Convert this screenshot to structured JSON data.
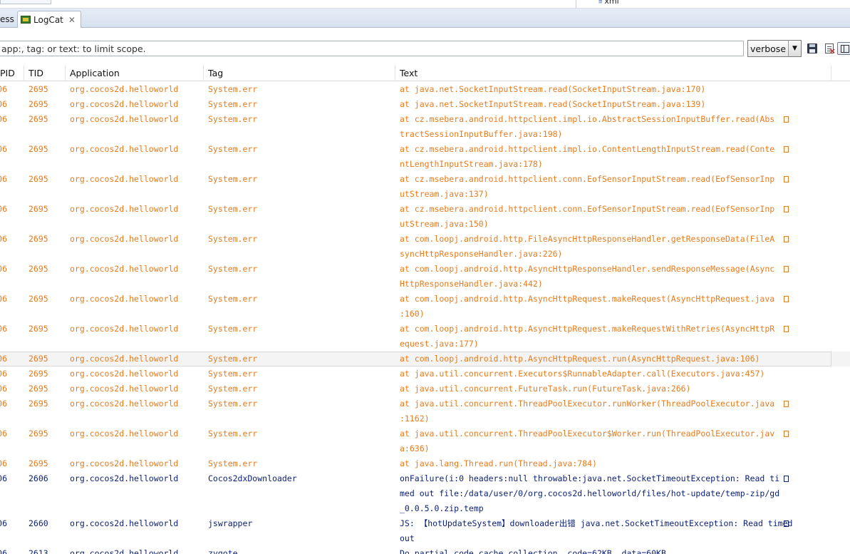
{
  "top": {
    "file_label": "xml"
  },
  "tabs": {
    "previous_label": "ess",
    "logcat_label": "LogCat"
  },
  "search": {
    "placeholder": "app:, tag: or text: to limit scope."
  },
  "level": {
    "value": "verbose"
  },
  "colors": {
    "warn_text": "#e87b1c",
    "info_text": "#0a1f78",
    "tab_bg": "#dde6f2"
  },
  "icons": {
    "tab": "logcat-icon",
    "close": "close-icon",
    "save": "save-icon",
    "clear": "clear-log-icon",
    "layout": "layout-toggle-icon"
  },
  "table": {
    "columns": [
      "PID",
      "TID",
      "Application",
      "Tag",
      "Text"
    ],
    "rows": [
      {
        "level": "warn",
        "pid": "06",
        "tid": "2695",
        "app": "org.cocos2d.helloworld",
        "tag": "System.err",
        "text": [
          "at java.net.SocketInputStream.read(SocketInputStream.java:170)"
        ]
      },
      {
        "level": "warn",
        "pid": "06",
        "tid": "2695",
        "app": "org.cocos2d.helloworld",
        "tag": "System.err",
        "text": [
          "at java.net.SocketInputStream.read(SocketInputStream.java:139)"
        ]
      },
      {
        "level": "warn",
        "pid": "06",
        "tid": "2695",
        "app": "org.cocos2d.helloworld",
        "tag": "System.err",
        "text": [
          "at cz.msebera.android.httpclient.impl.io.AbstractSessionInputBuffer.read(Abs",
          "tractSessionInputBuffer.java:198)"
        ]
      },
      {
        "level": "warn",
        "pid": "06",
        "tid": "2695",
        "app": "org.cocos2d.helloworld",
        "tag": "System.err",
        "text": [
          "at cz.msebera.android.httpclient.impl.io.ContentLengthInputStream.read(Conte",
          "ntLengthInputStream.java:178)"
        ]
      },
      {
        "level": "warn",
        "pid": "06",
        "tid": "2695",
        "app": "org.cocos2d.helloworld",
        "tag": "System.err",
        "text": [
          "at cz.msebera.android.httpclient.conn.EofSensorInputStream.read(EofSensorInp",
          "utStream.java:137)"
        ]
      },
      {
        "level": "warn",
        "pid": "06",
        "tid": "2695",
        "app": "org.cocos2d.helloworld",
        "tag": "System.err",
        "text": [
          "at cz.msebera.android.httpclient.conn.EofSensorInputStream.read(EofSensorInp",
          "utStream.java:150)"
        ]
      },
      {
        "level": "warn",
        "pid": "06",
        "tid": "2695",
        "app": "org.cocos2d.helloworld",
        "tag": "System.err",
        "text": [
          "at com.loopj.android.http.FileAsyncHttpResponseHandler.getResponseData(FileA",
          "syncHttpResponseHandler.java:226)"
        ]
      },
      {
        "level": "warn",
        "pid": "06",
        "tid": "2695",
        "app": "org.cocos2d.helloworld",
        "tag": "System.err",
        "text": [
          "at com.loopj.android.http.AsyncHttpResponseHandler.sendResponseMessage(Async",
          "HttpResponseHandler.java:442)"
        ]
      },
      {
        "level": "warn",
        "pid": "06",
        "tid": "2695",
        "app": "org.cocos2d.helloworld",
        "tag": "System.err",
        "text": [
          "at com.loopj.android.http.AsyncHttpRequest.makeRequest(AsyncHttpRequest.java",
          ":160)"
        ]
      },
      {
        "level": "warn",
        "pid": "06",
        "tid": "2695",
        "app": "org.cocos2d.helloworld",
        "tag": "System.err",
        "text": [
          "at com.loopj.android.http.AsyncHttpRequest.makeRequestWithRetries(AsyncHttpR",
          "equest.java:177)"
        ]
      },
      {
        "level": "warn",
        "selected": true,
        "pid": "06",
        "tid": "2695",
        "app": "org.cocos2d.helloworld",
        "tag": "System.err",
        "text": [
          "at com.loopj.android.http.AsyncHttpRequest.run(AsyncHttpRequest.java:106)"
        ]
      },
      {
        "level": "warn",
        "pid": "06",
        "tid": "2695",
        "app": "org.cocos2d.helloworld",
        "tag": "System.err",
        "text": [
          "at java.util.concurrent.Executors$RunnableAdapter.call(Executors.java:457)"
        ]
      },
      {
        "level": "warn",
        "pid": "06",
        "tid": "2695",
        "app": "org.cocos2d.helloworld",
        "tag": "System.err",
        "text": [
          "at java.util.concurrent.FutureTask.run(FutureTask.java:266)"
        ]
      },
      {
        "level": "warn",
        "pid": "06",
        "tid": "2695",
        "app": "org.cocos2d.helloworld",
        "tag": "System.err",
        "text": [
          "at java.util.concurrent.ThreadPoolExecutor.runWorker(ThreadPoolExecutor.java",
          ":1162)"
        ]
      },
      {
        "level": "warn",
        "pid": "06",
        "tid": "2695",
        "app": "org.cocos2d.helloworld",
        "tag": "System.err",
        "text": [
          "at java.util.concurrent.ThreadPoolExecutor$Worker.run(ThreadPoolExecutor.jav",
          "a:636)"
        ]
      },
      {
        "level": "warn",
        "pid": "06",
        "tid": "2695",
        "app": "org.cocos2d.helloworld",
        "tag": "System.err",
        "text": [
          "at java.lang.Thread.run(Thread.java:784)"
        ]
      },
      {
        "level": "info",
        "pid": "06",
        "tid": "2606",
        "app": "org.cocos2d.helloworld",
        "tag": "Cocos2dxDownloader",
        "text": [
          "onFailure(i:0 headers:null throwable:java.net.SocketTimeoutException: Read ti",
          "med out file:/data/user/0/org.cocos2d.helloworld/files/hot-update/temp-zip/gd",
          "_0.0.5.0.zip.temp"
        ]
      },
      {
        "level": "info",
        "pid": "06",
        "tid": "2660",
        "app": "org.cocos2d.helloworld",
        "tag": "jswrapper",
        "text": [
          "JS: 【hotUpdateSystem】downloader出错 java.net.SocketTimeoutException: Read timed",
          " out"
        ]
      },
      {
        "level": "info",
        "pid": "06",
        "tid": "2613",
        "app": "org.cocos2d.helloworld",
        "tag": "zygote",
        "text": [
          "Do partial code cache collection, code=62KB, data=60KB"
        ]
      }
    ]
  }
}
